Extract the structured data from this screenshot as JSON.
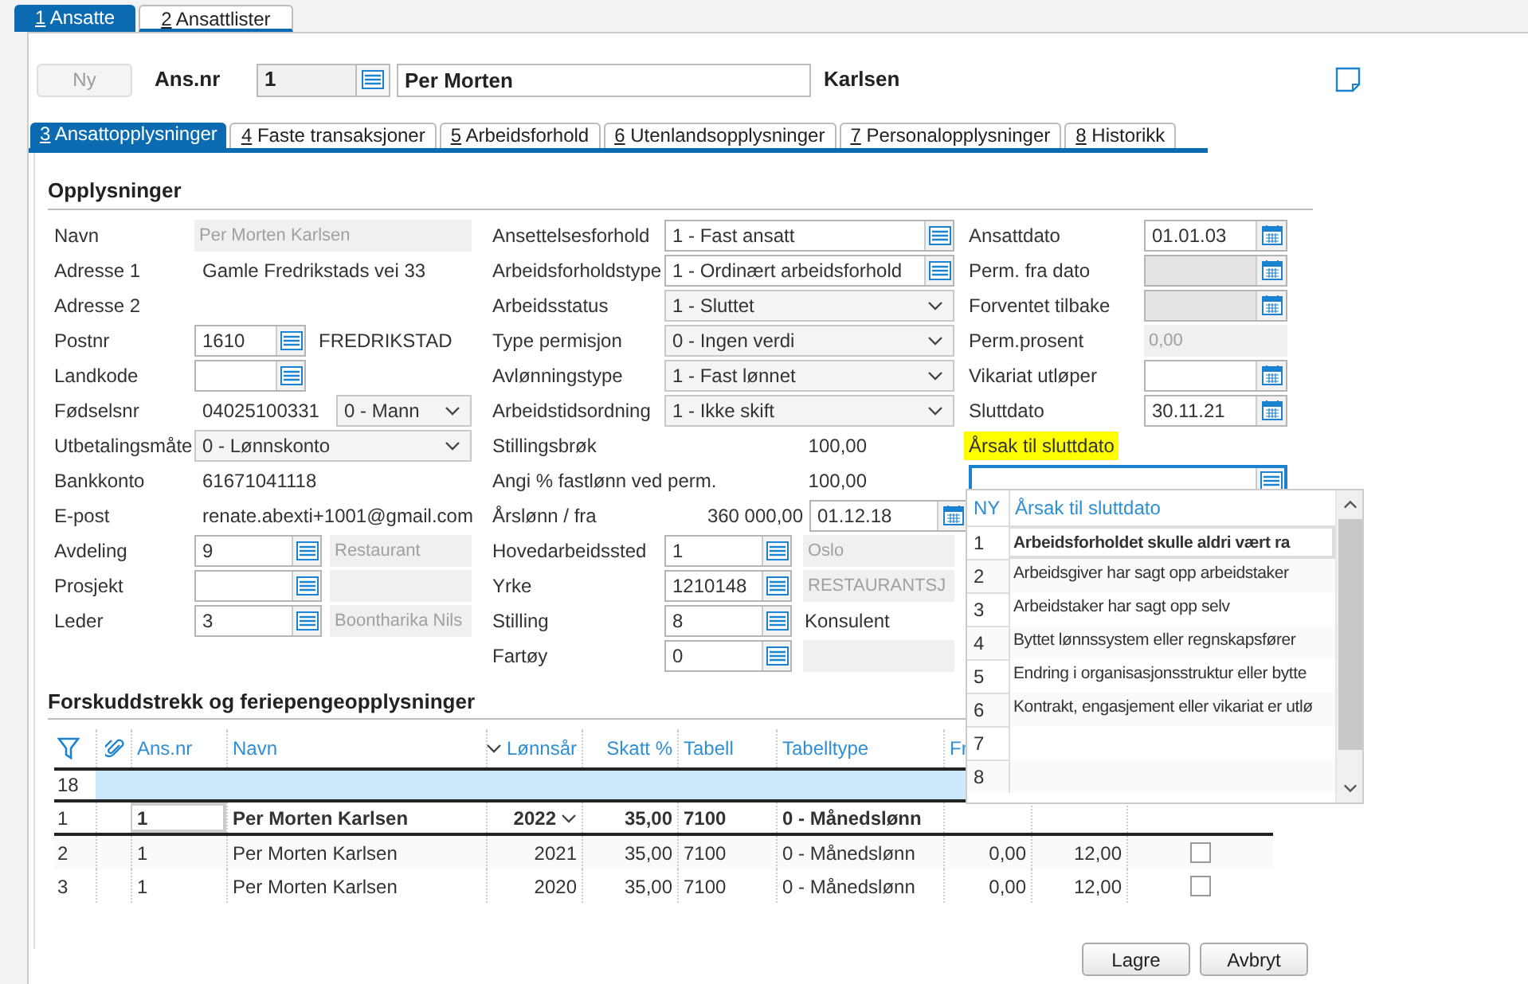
{
  "main_tabs": [
    {
      "key": "1",
      "label": "Ansatte",
      "selected": true
    },
    {
      "key": "2",
      "label": "Ansattlister",
      "selected": false
    }
  ],
  "header": {
    "new_button": {
      "label": "Ny",
      "disabled": true
    },
    "employee_label": "Ans.nr",
    "employee_number": "1",
    "first_name": "Per Morten",
    "last_name": "Karlsen"
  },
  "sub_tabs": [
    {
      "key": "3",
      "label": "Ansattopplysninger",
      "selected": true
    },
    {
      "key": "4",
      "label": "Faste transaksjoner",
      "selected": false
    },
    {
      "key": "5",
      "label": "Arbeidsforhold",
      "selected": false
    },
    {
      "key": "6",
      "label": "Utenlandsopplysninger",
      "selected": false
    },
    {
      "key": "7",
      "label": "Personalopplysninger",
      "selected": false
    },
    {
      "key": "8",
      "label": "Historikk",
      "selected": false
    }
  ],
  "section_title": "Opplysninger",
  "columns": [
    [
      {
        "label": "Navn",
        "kind": "disabled",
        "value": "Per Morten Karlsen"
      },
      {
        "label": "Adresse 1",
        "kind": "text",
        "value": "Gamle Fredrikstads vei 33"
      },
      {
        "label": "Adresse 2",
        "kind": "text"
      },
      {
        "label": "Postnr",
        "kind": "lookup",
        "value": "1610",
        "extra": {
          "kind": "text",
          "value": "FREDRIKSTAD"
        }
      },
      {
        "label": "Landkode",
        "kind": "lookup",
        "extra": {
          "kind": "none"
        }
      },
      {
        "label": "Fødselsnr",
        "kind": "text",
        "value": "04025100331",
        "extra": {
          "kind": "select",
          "value": "0 - Mann"
        }
      },
      {
        "label": "Utbetalingsmåte",
        "kind": "select",
        "value": "0 - Lønnskonto"
      },
      {
        "label": "Bankkonto",
        "kind": "text",
        "value": "61671041118"
      },
      {
        "label": "E-post",
        "kind": "text",
        "value": "renate.abexti+1001@gmail.com"
      },
      {
        "label": "Avdeling",
        "kind": "lookup",
        "value": "9",
        "extra": {
          "kind": "disabled",
          "value": "Restaurant"
        }
      },
      {
        "label": "Prosjekt",
        "kind": "lookup",
        "extra": {
          "kind": "disabled"
        }
      },
      {
        "label": "Leder",
        "kind": "lookup",
        "value": "3",
        "extra": {
          "kind": "disabled",
          "value": "Boontharika Nils"
        }
      }
    ],
    [
      {
        "label": "Ansettelsesforhold",
        "kind": "lookup",
        "value": "1 - Fast ansatt"
      },
      {
        "label": "Arbeidsforholdstype",
        "kind": "lookup",
        "value": "1 - Ordinært arbeidsforhold"
      },
      {
        "label": "Arbeidsstatus",
        "kind": "select",
        "value": "1 - Sluttet"
      },
      {
        "label": "Type permisjon",
        "kind": "select",
        "value": "0 - Ingen verdi"
      },
      {
        "label": "Avlønningstype",
        "kind": "select",
        "value": "1 - Fast lønnet"
      },
      {
        "label": "Arbeidstidsordning",
        "kind": "select",
        "value": "1 - Ikke skift"
      },
      {
        "label": "Stillingsbrøk",
        "kind": "amount",
        "value": "100,00"
      },
      {
        "label": "Angi % fastlønn ved perm.",
        "kind": "amount",
        "value": "100,00"
      },
      {
        "label": "Årslønn / fra",
        "kind": "amount",
        "value": "360 000,00",
        "extra": {
          "kind": "date",
          "value": "01.12.18"
        }
      },
      {
        "label": "Hovedarbeidssted",
        "kind": "lookup",
        "value": "1",
        "extra": {
          "kind": "disabled",
          "value": "Oslo"
        }
      },
      {
        "label": "Yrke",
        "kind": "lookup",
        "value": "1210148",
        "extra": {
          "kind": "disabled",
          "value": "RESTAURANTSJ"
        }
      },
      {
        "label": "Stilling",
        "kind": "lookup",
        "value": "8",
        "extra": {
          "kind": "text",
          "value": "Konsulent"
        }
      },
      {
        "label": "Fartøy",
        "kind": "lookup",
        "value": "0",
        "extra": {
          "kind": "disabled"
        }
      }
    ],
    [
      {
        "label": "Ansattdato",
        "kind": "date",
        "value": "01.01.03",
        "disabled": false
      },
      {
        "label": "Perm. fra dato",
        "kind": "date",
        "disabled": true
      },
      {
        "label": "Forventet tilbake",
        "kind": "date",
        "disabled": true
      },
      {
        "label": "Perm.prosent",
        "kind": "disabled",
        "value": "0,00"
      },
      {
        "label": "Vikariat utløper",
        "kind": "date",
        "disabled": false
      },
      {
        "label": "Sluttdato",
        "kind": "date",
        "value": "30.11.21",
        "disabled": false
      },
      {
        "label": "Årsak til sluttdato",
        "kind": "heading",
        "highlighted": true
      },
      {
        "kind": "lookup",
        "focused": true
      }
    ]
  ],
  "reason_list": {
    "columns": [
      "NY",
      "Årsak til sluttdato"
    ],
    "rows": [
      {
        "num": "1",
        "text": "Arbeidsforholdet skulle aldri vært ra",
        "selected": true
      },
      {
        "num": "2",
        "text": "Arbeidsgiver har sagt opp arbeidstaker",
        "selected": false
      },
      {
        "num": "3",
        "text": "Arbeidstaker har sagt opp selv",
        "selected": false
      },
      {
        "num": "4",
        "text": "Byttet lønnssystem eller regnskapsfører",
        "selected": false
      },
      {
        "num": "5",
        "text": "Endring i organisasjonsstruktur eller bytte",
        "selected": false
      },
      {
        "num": "6",
        "text": "Kontrakt, engasjement eller vikariat er utlø",
        "selected": false
      },
      {
        "num": "7",
        "selected": false
      },
      {
        "num": "8",
        "selected": false
      }
    ]
  },
  "table_title": "Forskuddstrekk og feriepengeopplysninger",
  "table": {
    "columns": [
      {
        "label": "Ans.nr"
      },
      {
        "label": "Navn"
      },
      {
        "label": "Lønnsår",
        "sorted": true
      },
      {
        "label": "Skatt %"
      },
      {
        "label": "Tabell"
      },
      {
        "label": "Tabelltype"
      },
      {
        "label": "Fr"
      },
      {},
      {}
    ],
    "filter_count": "18",
    "rows": [
      {
        "num": "1",
        "selected": true,
        "cells": [
          "1",
          "Per Morten Karlsen",
          "2022",
          "35,00",
          "7100",
          "0 - Månedslønn"
        ]
      },
      {
        "num": "2",
        "selected": false,
        "cells": [
          "1",
          "Per Morten Karlsen",
          "2021",
          "35,00",
          "7100",
          "0 - Månedslønn",
          "0,00",
          "12,00"
        ],
        "checked": false
      },
      {
        "num": "3",
        "selected": false,
        "cells": [
          "1",
          "Per Morten Karlsen",
          "2020",
          "35,00",
          "7100",
          "0 - Månedslønn",
          "0,00",
          "12,00"
        ],
        "checked": false
      }
    ]
  },
  "buttons": [
    "Lagre",
    "Avbryt"
  ]
}
